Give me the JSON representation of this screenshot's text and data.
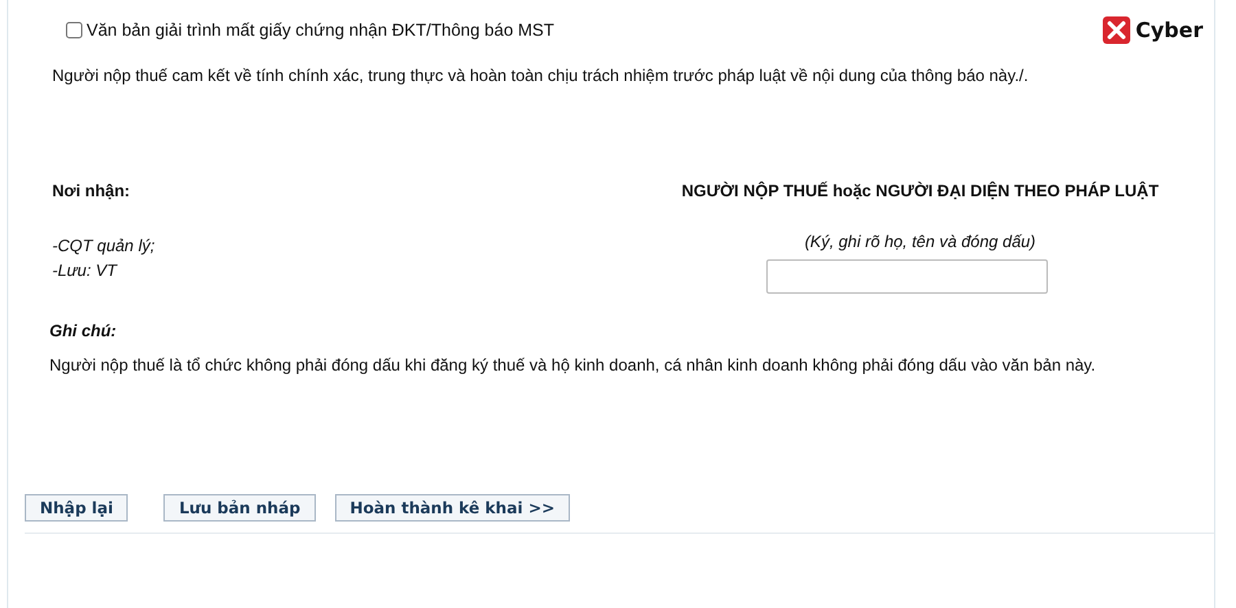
{
  "attachment": {
    "label": "Văn bản giải trình mất giấy chứng nhận ĐKT/Thông báo MST",
    "checked": false
  },
  "logo": {
    "text": "Cyber"
  },
  "commitment": "Người nộp thuế cam kết về tính chính xác, trung thực và hoàn toàn chịu trách nhiệm trước pháp luật về nội dung của thông báo này./.",
  "recipients": {
    "title": "Nơi nhận:",
    "lines": [
      "-CQT quản lý;",
      "-Lưu: VT"
    ]
  },
  "signer": {
    "title": "NGƯỜI NỘP THUẾ hoặc NGƯỜI ĐẠI DIỆN THEO PHÁP LUẬT",
    "hint": "(Ký, ghi rõ họ, tên và đóng dấu)"
  },
  "note": {
    "title": "Ghi chú:",
    "text": "Người nộp thuế là tổ chức không phải đóng dấu khi đăng ký thuế và hộ kinh doanh, cá nhân kinh doanh không phải đóng dấu vào văn bản này."
  },
  "buttons": [
    "Nhập lại",
    "Lưu bản nháp",
    "Hoàn thành kê khai >>"
  ]
}
